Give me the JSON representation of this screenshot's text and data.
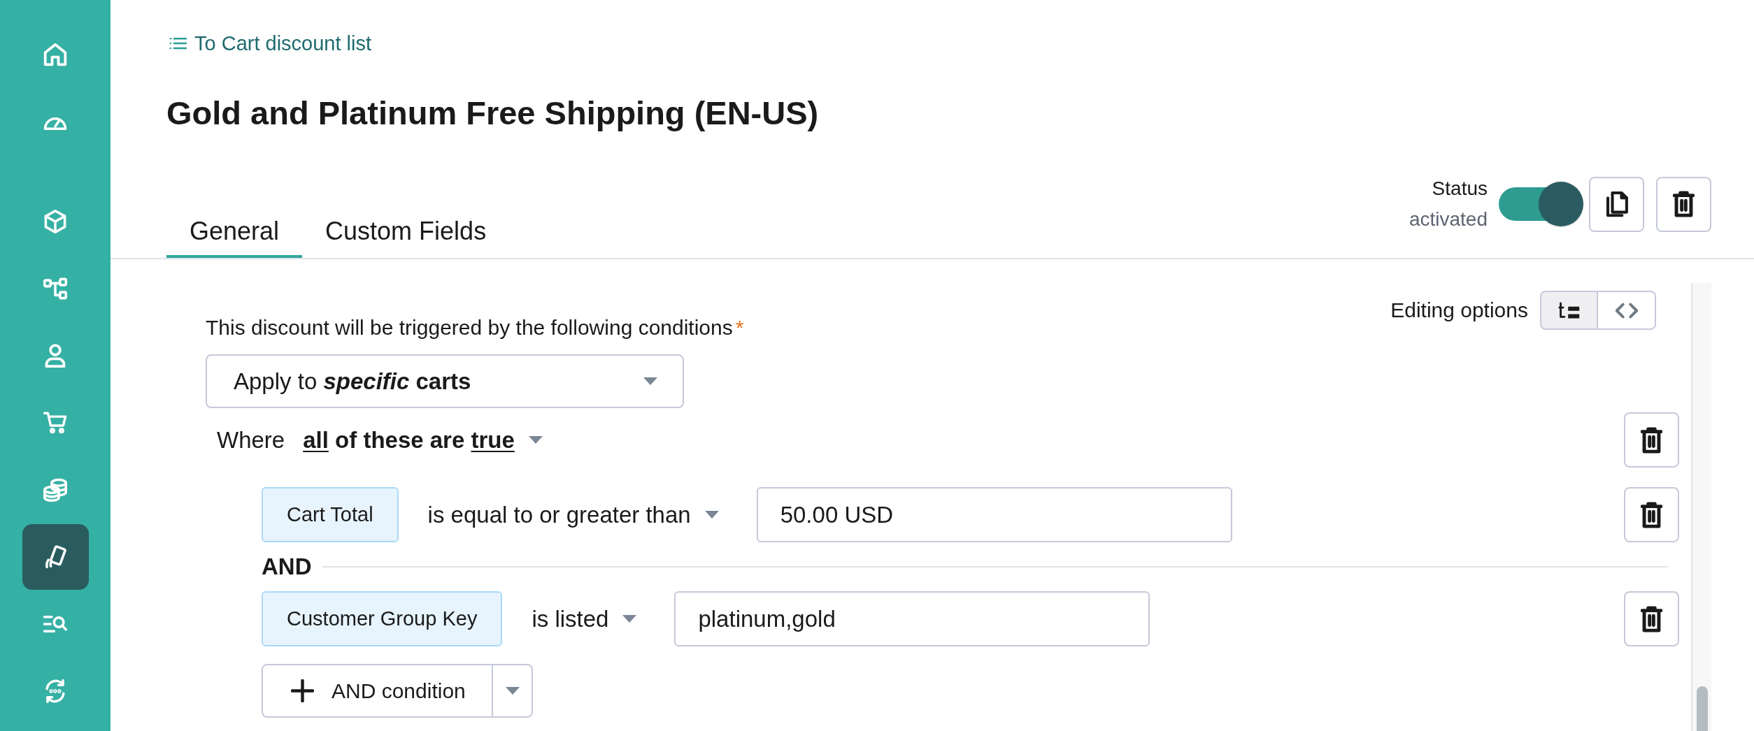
{
  "sidebar": {
    "groups": [
      {
        "items": [
          {
            "kind": "home",
            "selected": false
          },
          {
            "kind": "gauge",
            "selected": false
          }
        ]
      },
      {
        "items": [
          {
            "kind": "cube",
            "selected": false
          },
          {
            "kind": "hierarchy",
            "selected": false
          },
          {
            "kind": "person",
            "selected": false
          },
          {
            "kind": "cart",
            "selected": false
          },
          {
            "kind": "coins",
            "selected": false
          },
          {
            "kind": "card",
            "selected": true
          },
          {
            "kind": "list-search",
            "selected": false
          },
          {
            "kind": "sync",
            "selected": false
          }
        ]
      }
    ]
  },
  "breadcrumb": {
    "label": "To Cart discount list"
  },
  "title": "Gold and Platinum Free Shipping (EN-US)",
  "tabs": [
    {
      "label": "General",
      "selected": true
    },
    {
      "label": "Custom Fields",
      "selected": false
    }
  ],
  "status": {
    "label": "Status",
    "value": "activated",
    "on": true
  },
  "conditions": {
    "label": "This discount will be triggered by the following conditions",
    "required_mark": "*",
    "editing_options": {
      "label": "Editing options",
      "modes": [
        {
          "kind": "tree",
          "selected": true
        },
        {
          "kind": "code",
          "selected": false
        }
      ]
    },
    "target": {
      "value": "Apply to ***specific* carts**"
    },
    "match": {
      "label": "Where",
      "quantifier": "all",
      "connector": "of these are",
      "truth": "true"
    },
    "rules": [
      {
        "field": "Cart Total",
        "operator": "is equal to or greater than",
        "value": "50.00 USD"
      },
      {
        "joiner": "AND",
        "field": "Customer Group Key",
        "operator": "is listed",
        "value": "platinum,gold"
      }
    ],
    "add_button": {
      "label": "AND condition"
    }
  }
}
